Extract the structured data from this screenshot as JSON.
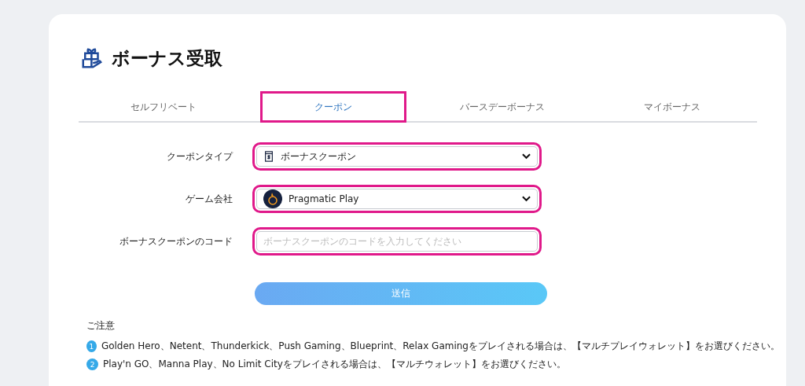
{
  "title": "ボーナス受取",
  "tabs": [
    {
      "label": "セルフリベート",
      "selected": false,
      "highlighted": false
    },
    {
      "label": "クーポン",
      "selected": true,
      "highlighted": true
    },
    {
      "label": "バースデーボーナス",
      "selected": false,
      "highlighted": false
    },
    {
      "label": "マイボーナス",
      "selected": false,
      "highlighted": false
    }
  ],
  "fields": [
    {
      "kind": "select",
      "label": "クーポンタイプ",
      "value": "ボーナスクーポン",
      "highlighted": true
    },
    {
      "kind": "select",
      "label": "ゲーム会社",
      "value": "Pragmatic Play",
      "highlighted": true
    },
    {
      "kind": "input",
      "label": "ボーナスクーポンのコード",
      "placeholder": "ボーナスクーポンのコードを入力してください",
      "highlighted": true
    }
  ],
  "submit": "送信",
  "notes": {
    "heading": "ご注意",
    "items": [
      {
        "number": "1",
        "text": "Golden Hero、Netent、Thunderkick、Push Gaming、Blueprint、Relax Gamingをプレイされる場合は、【マルチプレイウォレット】をお選びください。"
      },
      {
        "number": "2",
        "text": "Play'n GO、Manna Play、No Limit Cityをプレイされる場合は、【マルチウォレット】をお選びください。"
      }
    ]
  }
}
